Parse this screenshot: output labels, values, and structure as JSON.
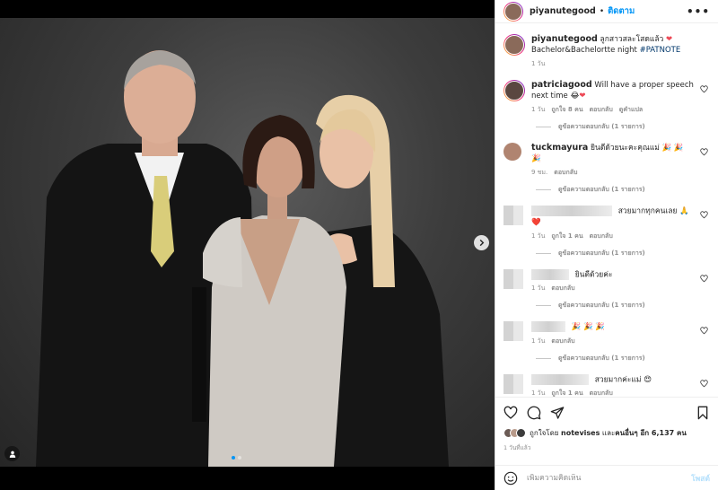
{
  "post": {
    "username": "piyanutegood",
    "separator": "•",
    "follow_label": "ติดตาม",
    "more_label": "•••"
  },
  "caption": {
    "username": "piyanutegood",
    "text": "ลูกสาวสละโสดแล้ว",
    "line2": "Bachelor&Bachelortte night",
    "hashtag": "#PATNOTE",
    "time": "1 วัน"
  },
  "comments": [
    {
      "username": "patriciagood",
      "text": "Will have a proper speech next time",
      "time": "1 วัน",
      "likes": "ถูกใจ 8 คน",
      "reply": "ตอบกลับ",
      "translate": "ดูคำแปล",
      "view_replies": "ดูข้อความตอบกลับ (1 รายการ)"
    },
    {
      "username": "tuckmayura",
      "text": "ยินดีด้วยนะคะคุณแม่ 🎉 🎉 🎉",
      "time": "9 ชม.",
      "reply": "ตอบกลับ",
      "view_replies": "ดูข้อความตอบกลับ (1 รายการ)"
    },
    {
      "text": "สวยมากทุกคนเลย 🙏 ❤️",
      "time": "1 วัน",
      "likes": "ถูกใจ 1 คน",
      "reply": "ตอบกลับ",
      "view_replies": "ดูข้อความตอบกลับ (1 รายการ)"
    },
    {
      "text": "ยินดีด้วยค่ะ",
      "time": "1 วัน",
      "reply": "ตอบกลับ",
      "view_replies": "ดูข้อความตอบกลับ (1 รายการ)"
    },
    {
      "text": "🎉 🎉 🎉",
      "time": "1 วัน",
      "reply": "ตอบกลับ",
      "view_replies": "ดูข้อความตอบกลับ (1 รายการ)"
    },
    {
      "text": "สวยมากค่ะแม่ 😍",
      "time": "1 วัน",
      "likes": "ถูกใจ 1 คน",
      "reply": "ตอบกลับ"
    }
  ],
  "likes": {
    "prefix": "ถูกใจโดย",
    "user": "notevises",
    "middle": "และ",
    "others": "คนอื่นๆ อีก 6,137 คน"
  },
  "post_time": "1 วันที่แล้ว",
  "add_comment": {
    "placeholder": "เพิ่มความคิดเห็น",
    "post_label": "โพสต์"
  },
  "colors": {
    "accent": "#0095f6",
    "heart": "#ed4956",
    "muted": "#8e8e8e"
  }
}
